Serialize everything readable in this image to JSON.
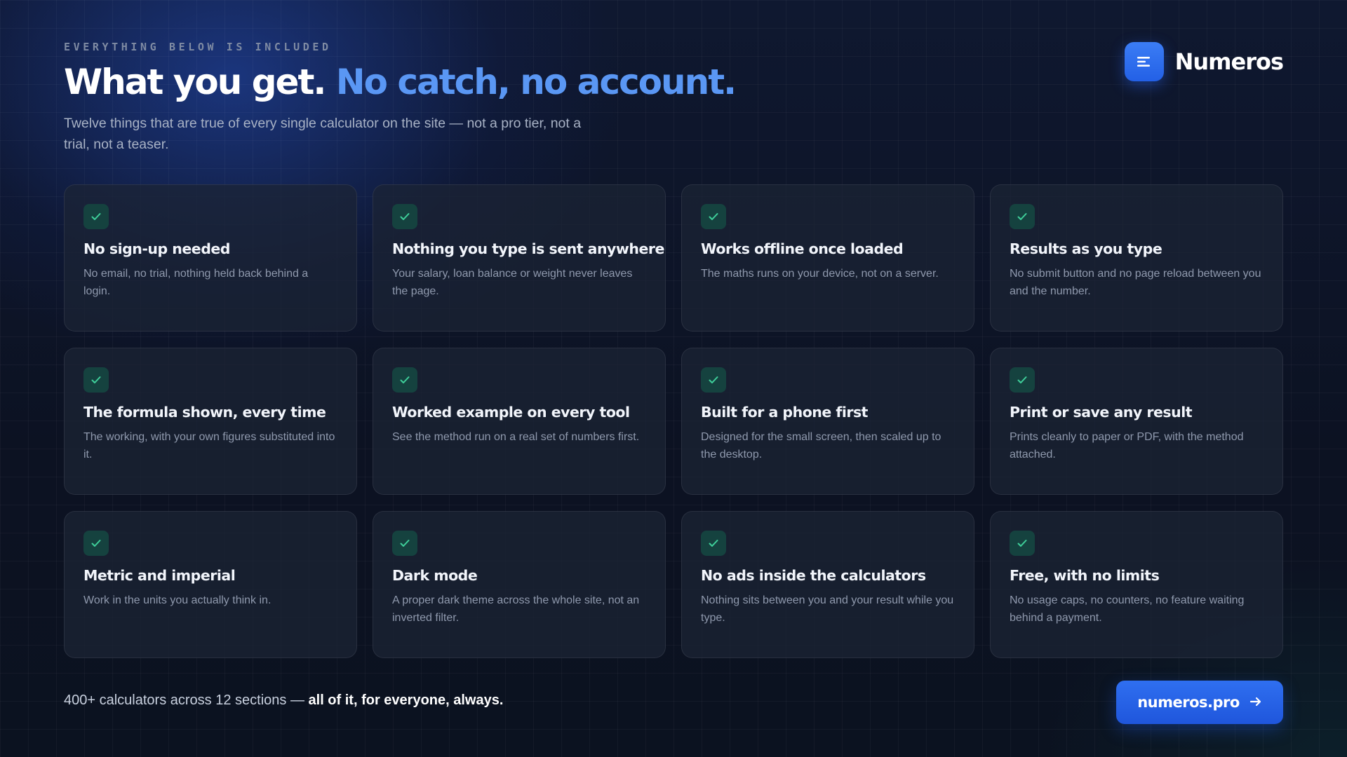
{
  "header": {
    "eyebrow": "EVERYTHING BELOW IS INCLUDED",
    "title_main": "What you get.",
    "title_accent": "No catch, no account.",
    "subtitle": "Twelve things that are true of every single calculator on the site — not a pro tier, not a trial, not a teaser."
  },
  "brand": {
    "name": "Numeros",
    "logo_icon": "menu-lines-icon"
  },
  "features": [
    {
      "title": "No sign-up needed",
      "desc": "No email, no trial, nothing held back behind a login."
    },
    {
      "title": "Nothing you type is sent anywhere",
      "desc": "Your salary, loan balance or weight never leaves the page."
    },
    {
      "title": "Works offline once loaded",
      "desc": "The maths runs on your device, not on a server."
    },
    {
      "title": "Results as you type",
      "desc": "No submit button and no page reload between you and the number."
    },
    {
      "title": "The formula shown, every time",
      "desc": "The working, with your own figures substituted into it."
    },
    {
      "title": "Worked example on every tool",
      "desc": "See the method run on a real set of numbers first."
    },
    {
      "title": "Built for a phone first",
      "desc": "Designed for the small screen, then scaled up to the desktop."
    },
    {
      "title": "Print or save any result",
      "desc": "Prints cleanly to paper or PDF, with the method attached."
    },
    {
      "title": "Metric and imperial",
      "desc": "Work in the units you actually think in."
    },
    {
      "title": "Dark mode",
      "desc": "A proper dark theme across the whole site, not an inverted filter."
    },
    {
      "title": "No ads inside the calculators",
      "desc": "Nothing sits between you and your result while you type."
    },
    {
      "title": "Free, with no limits",
      "desc": "No usage caps, no counters, no feature waiting behind a payment."
    }
  ],
  "footer": {
    "text_plain": "400+ calculators across 12 sections — ",
    "text_bold": "all of it, for everyone, always.",
    "cta_label": "numeros.pro",
    "cta_icon": "arrow-right-icon"
  },
  "colors": {
    "accent": "#5a97f4",
    "brand_blue": "#2f6ff0",
    "check_green": "#3fcf9a",
    "background": "#0c1322"
  }
}
